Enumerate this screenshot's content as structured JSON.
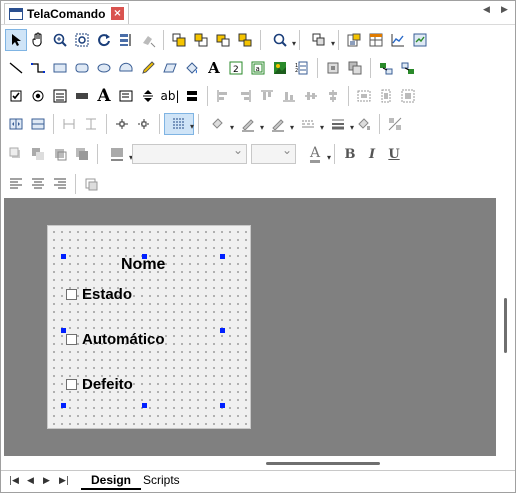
{
  "window": {
    "title": "TelaComando",
    "close_label": "×",
    "nav_prev": "◀",
    "nav_next": "▶"
  },
  "toolbar": {
    "row1": [
      "select-pointer",
      "hand-pan",
      "zoom",
      "zoom-fit",
      "refresh",
      "align-grid",
      "clear-format",
      "bring-front",
      "send-back",
      "group",
      "ungroup",
      "find",
      "arrange",
      "properties",
      "table-view",
      "chart",
      "report"
    ],
    "row2": [
      "line",
      "connector-line",
      "rectangle",
      "rounded-rect",
      "ellipse",
      "arc",
      "pencil",
      "parallelogram",
      "fill-bucket",
      "text",
      "number-field",
      "image-frame",
      "picture",
      "numbered-list",
      "align-center",
      "arrange-objects",
      "link-a",
      "link-b"
    ],
    "text_glyph": "A",
    "label_glyph": "ab|",
    "font_bold": "B",
    "font_italic": "I",
    "font_underline": "U",
    "font_color_glyph": "A"
  },
  "design": {
    "title_label": "Nome",
    "checkboxes": [
      {
        "label": "Estado",
        "checked": false
      },
      {
        "label": "Automático",
        "checked": false
      },
      {
        "label": "Defeito",
        "checked": false
      }
    ]
  },
  "bottom": {
    "nav": [
      "|◀",
      "◀",
      "▶",
      "▶|"
    ],
    "tabs": [
      {
        "label": "Design",
        "active": true
      },
      {
        "label": "Scripts",
        "active": false
      }
    ]
  }
}
